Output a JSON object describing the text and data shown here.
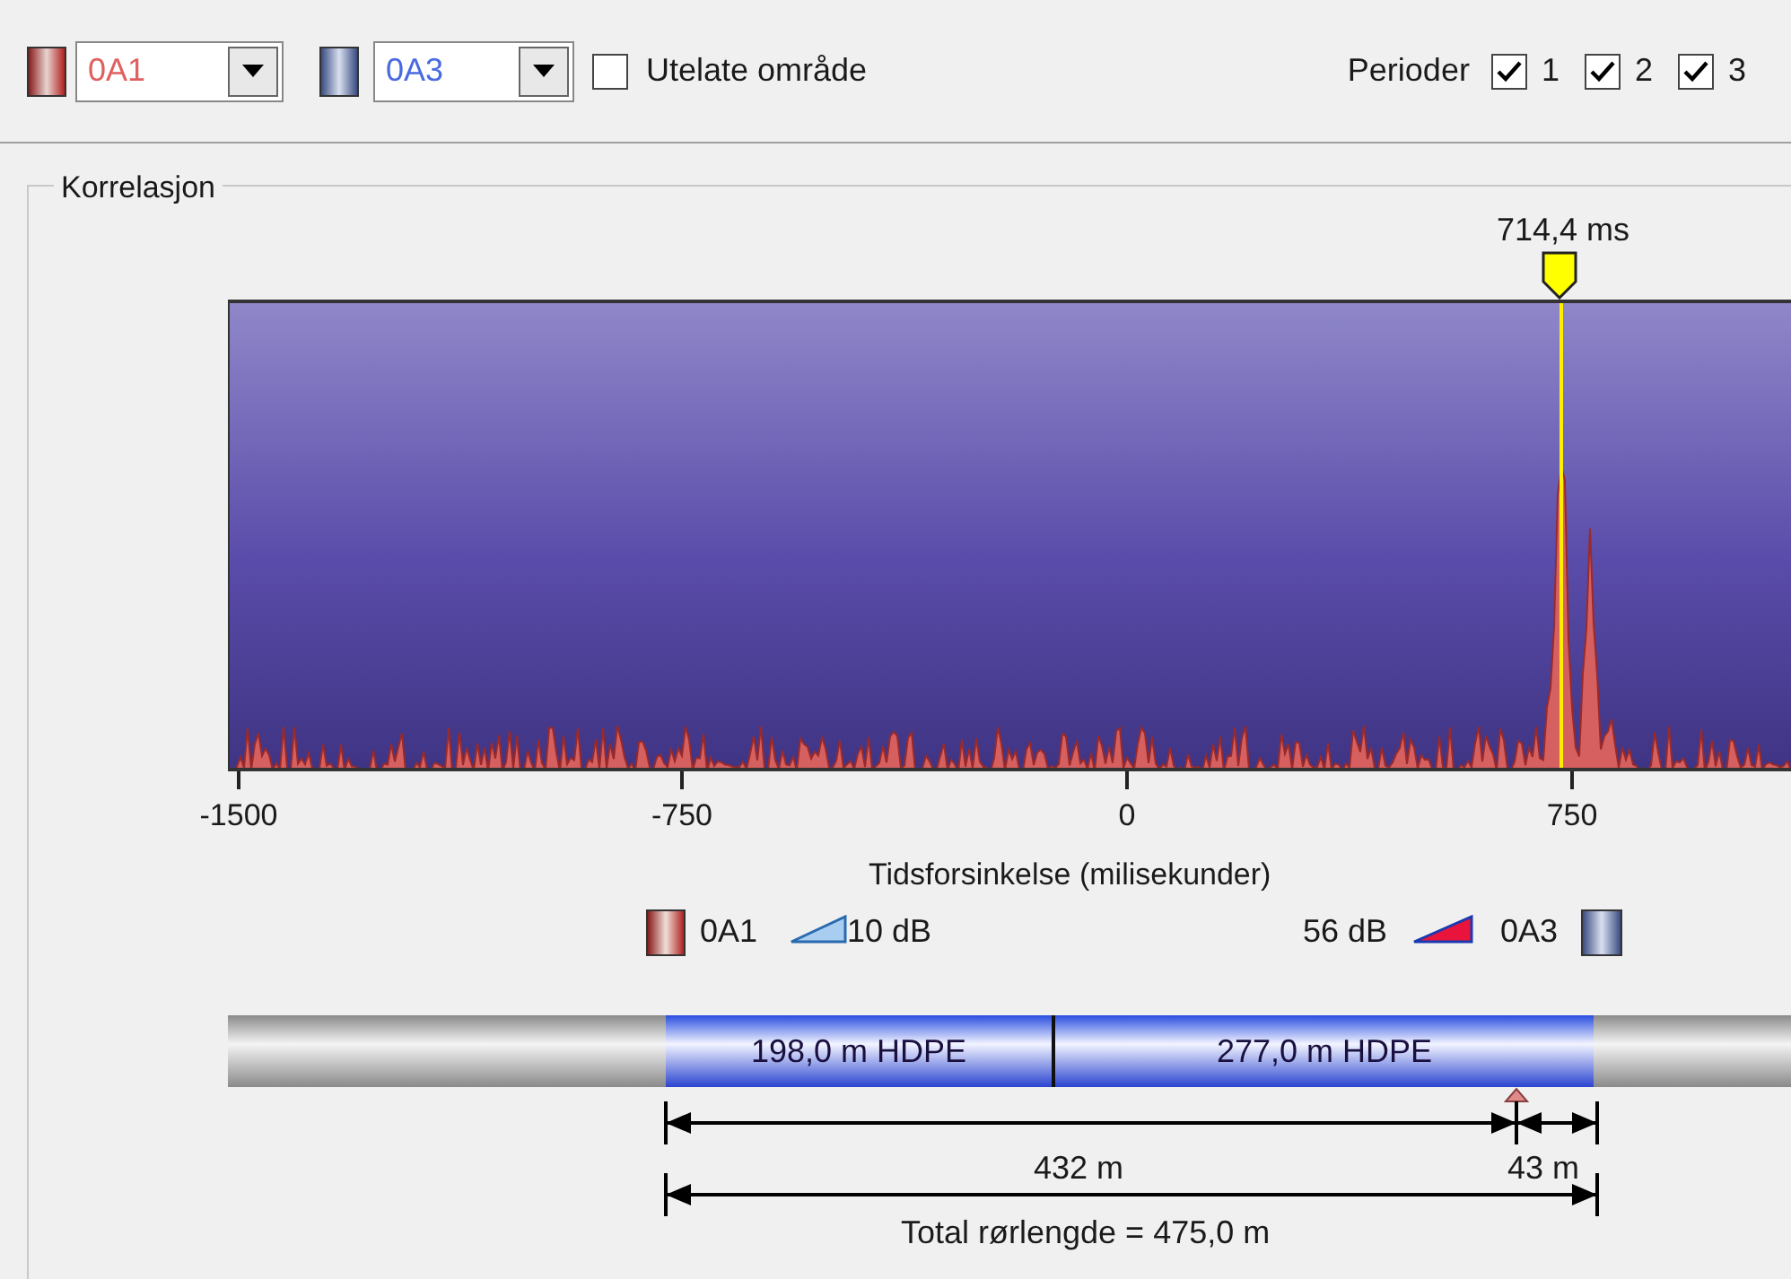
{
  "toolbar": {
    "channel_a": {
      "value": "0A1"
    },
    "channel_b": {
      "value": "0A3"
    },
    "exclude_area": {
      "label": "Utelate område",
      "checked": false
    },
    "periods": {
      "label": "Perioder",
      "items": [
        {
          "label": "1",
          "checked": true
        },
        {
          "label": "2",
          "checked": true
        },
        {
          "label": "3",
          "checked": true
        }
      ]
    }
  },
  "correlation": {
    "title": "Korrelasjon",
    "marker": {
      "label": "714,4 ms"
    },
    "x_ticks": [
      "-1500",
      "-750",
      "0",
      "750"
    ],
    "x_label": "Tidsforsinkelse (milisekunder)",
    "legend": {
      "left": {
        "channel": "0A1",
        "gain": "10 dB"
      },
      "right": {
        "gain": "56 dB",
        "channel": "0A3"
      }
    },
    "pipe": {
      "segments": [
        {
          "label": "198,0 m HDPE"
        },
        {
          "label": "277,0 m HDPE"
        }
      ]
    },
    "distances": {
      "to_a": "432 m",
      "to_b": "43 m",
      "total": "Total rørlengde = 475,0 m"
    }
  }
}
